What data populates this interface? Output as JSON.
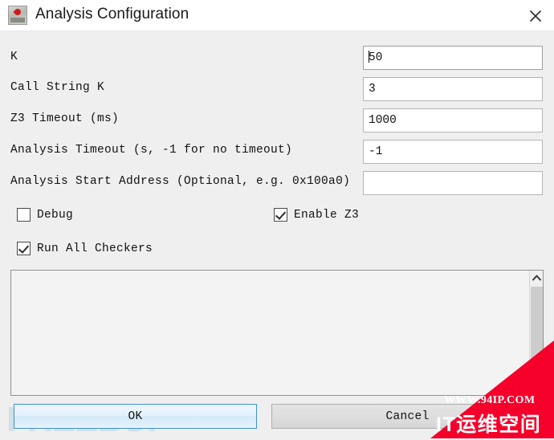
{
  "window": {
    "title": "Analysis Configuration",
    "icon": "app-icon",
    "close_label": "✕"
  },
  "form": {
    "fields": [
      {
        "label": "K",
        "value": "50",
        "focused": true,
        "placeholder": ""
      },
      {
        "label": "Call String K",
        "value": "3",
        "focused": false,
        "placeholder": ""
      },
      {
        "label": "Z3 Timeout (ms)",
        "value": "1000",
        "focused": false,
        "placeholder": ""
      },
      {
        "label": "Analysis Timeout (s, -1 for no timeout)",
        "value": "-1",
        "focused": false,
        "placeholder": ""
      },
      {
        "label": "Analysis Start Address (Optional, e.g. 0x100a0)",
        "value": "",
        "focused": false,
        "placeholder": ""
      }
    ]
  },
  "checkboxes": [
    {
      "label": "Debug",
      "checked": false
    },
    {
      "label": "Enable Z3",
      "checked": true
    },
    {
      "label": "Run All Checkers",
      "checked": true
    }
  ],
  "output": {
    "text": "",
    "scroll_up_icon": "chevron-up-icon"
  },
  "buttons": {
    "ok": "OK",
    "cancel": "Cancel"
  },
  "watermarks": {
    "freebuf": "FREEBUF",
    "banner_url": "WWW.94IP.COM",
    "banner_name": "IT运维空间",
    "banner_color": "#f5002b"
  }
}
